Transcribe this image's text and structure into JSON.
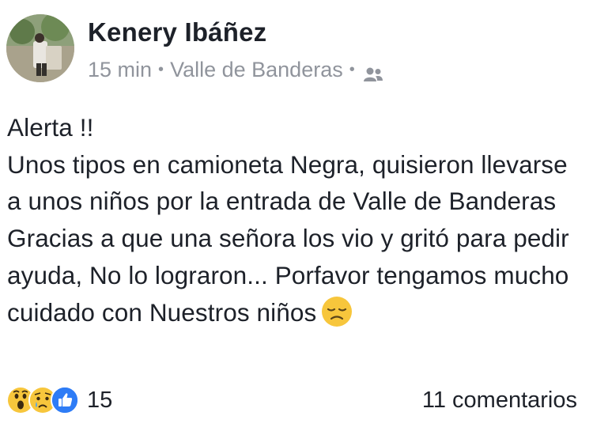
{
  "post": {
    "author": "Kenery Ibáñez",
    "time": "15 min",
    "separator": "•",
    "location": "Valle de Banderas",
    "privacy_icon": "friends-icon",
    "text_lines": [
      "Alerta !!",
      "Unos tipos en camioneta Negra, quisieron llevarse a unos niños por la entrada de Valle de Banderas Gracias a que una señora los vio y gritó para pedir ayuda, No lo lograron... Porfavor tengamos mucho cuidado con Nuestros niños"
    ],
    "trailing_emoji": "disappointed-face-emoji"
  },
  "footer": {
    "reaction_icons": [
      "wow-reaction-icon",
      "sad-reaction-icon",
      "like-reaction-icon"
    ],
    "reaction_count": "15",
    "comments": "11 comentarios"
  },
  "colors": {
    "text": "#1d2129",
    "secondary_text": "#90949c",
    "like_blue": "#2e7cf6",
    "emoji_yellow": "#f7c63c"
  }
}
